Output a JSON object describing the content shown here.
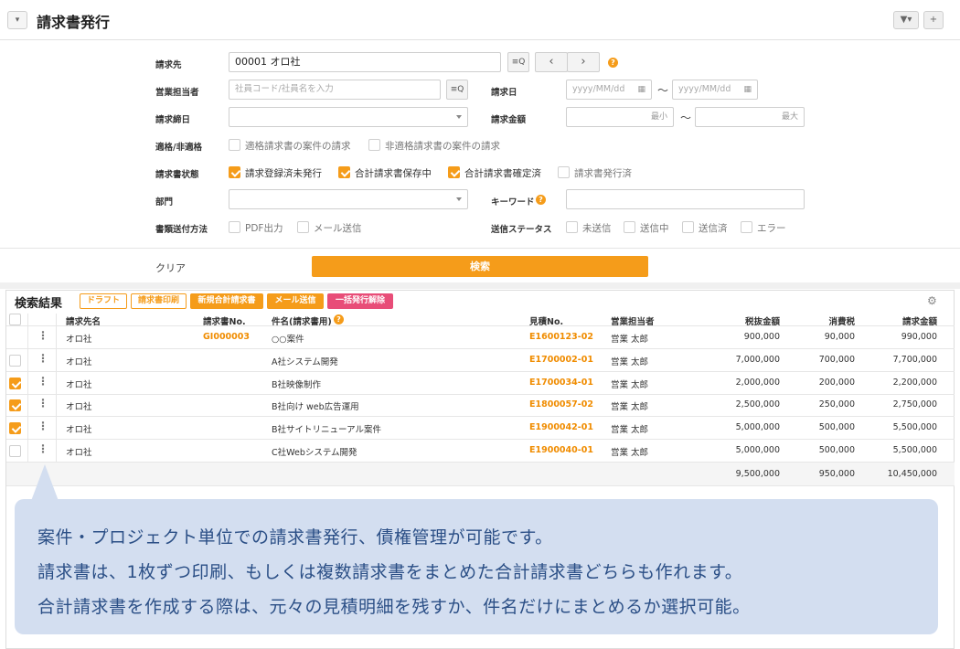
{
  "header": {
    "title": "請求書発行",
    "toggle_icon": "▾",
    "filter_icon": "▼▾",
    "folder_icon": "+"
  },
  "form": {
    "invoice_to_label": "請求先",
    "invoice_to_value": "00001 オロ社",
    "sales_rep_label": "営業担当者",
    "sales_rep_placeholder": "社員コード/社員名を入力",
    "invoice_date_label": "請求日",
    "date_placeholder": "yyyy/MM/dd",
    "tilde": "〜",
    "closing_date_label": "請求締日",
    "amount_label": "請求金額",
    "amount_min": "最小",
    "amount_max": "最大",
    "eligible_label": "適格/非適格",
    "eligible_options": [
      "適格請求書の案件の請求",
      "非適格請求書の案件の請求"
    ],
    "status_label": "請求書状態",
    "status_options": [
      {
        "label": "請求登録済未発行",
        "checked": true
      },
      {
        "label": "合計請求書保存中",
        "checked": true
      },
      {
        "label": "合計請求書確定済",
        "checked": true
      },
      {
        "label": "請求書発行済",
        "checked": false
      }
    ],
    "dept_label": "部門",
    "keyword_label": "キーワード",
    "send_method_label": "書類送付方法",
    "send_methods": [
      "PDF出力",
      "メール送信"
    ],
    "send_status_label": "送信ステータス",
    "send_statuses": [
      "未送信",
      "送信中",
      "送信済",
      "エラー"
    ],
    "clear_label": "クリア",
    "search_label": "検索"
  },
  "results": {
    "title": "検索結果",
    "tags": [
      "ドラフト",
      "請求書印刷",
      "新規合計請求書",
      "メール送信",
      "一括発行解除"
    ],
    "columns": [
      "請求先名",
      "請求書No.",
      "件名(請求書用)",
      "見積No.",
      "営業担当者",
      "税抜金額",
      "消費税",
      "請求金額"
    ],
    "rows": [
      {
        "checked": false,
        "hidden_cb": true,
        "client": "オロ社",
        "invoice_no": "GI000003",
        "subject": "○○案件",
        "quote_no": "E1600123-02",
        "rep": "営業 太郎",
        "net": "900,000",
        "tax": "90,000",
        "total": "990,000"
      },
      {
        "checked": false,
        "hidden_cb": false,
        "client": "オロ社",
        "invoice_no": "",
        "subject": "A社システム開発",
        "quote_no": "E1700002-01",
        "rep": "営業 太郎",
        "net": "7,000,000",
        "tax": "700,000",
        "total": "7,700,000"
      },
      {
        "checked": true,
        "hidden_cb": false,
        "client": "オロ社",
        "invoice_no": "",
        "subject": "B社映像制作",
        "quote_no": "E1700034-01",
        "rep": "営業 太郎",
        "net": "2,000,000",
        "tax": "200,000",
        "total": "2,200,000"
      },
      {
        "checked": true,
        "hidden_cb": false,
        "client": "オロ社",
        "invoice_no": "",
        "subject": "B社向け web広告運用",
        "quote_no": "E1800057-02",
        "rep": "営業 太郎",
        "net": "2,500,000",
        "tax": "250,000",
        "total": "2,750,000"
      },
      {
        "checked": true,
        "hidden_cb": false,
        "client": "オロ社",
        "invoice_no": "",
        "subject": "B社サイトリニューアル案件",
        "quote_no": "E1900042-01",
        "rep": "営業 太郎",
        "net": "5,000,000",
        "tax": "500,000",
        "total": "5,500,000"
      },
      {
        "checked": false,
        "hidden_cb": false,
        "client": "オロ社",
        "invoice_no": "",
        "subject": "C社Webシステム開発",
        "quote_no": "E1900040-01",
        "rep": "営業 太郎",
        "net": "5,000,000",
        "tax": "500,000",
        "total": "5,500,000"
      }
    ],
    "totals": {
      "net": "9,500,000",
      "tax": "950,000",
      "total": "10,450,000"
    }
  },
  "callout": {
    "lines": [
      "案件・プロジェクト単位での請求書発行、債権管理が可能です。",
      "請求書は、1枚ずつ印刷、もしくは複数請求書をまとめた合計請求書どちらも作れます。",
      "合計請求書を作成する際は、元々の見積明細を残すか、件名だけにまとめるか選択可能。"
    ]
  },
  "colors": {
    "accent": "#f59c1a",
    "pink": "#e84d78",
    "callout_bg": "#d3def0",
    "callout_text": "#2b4f86"
  }
}
